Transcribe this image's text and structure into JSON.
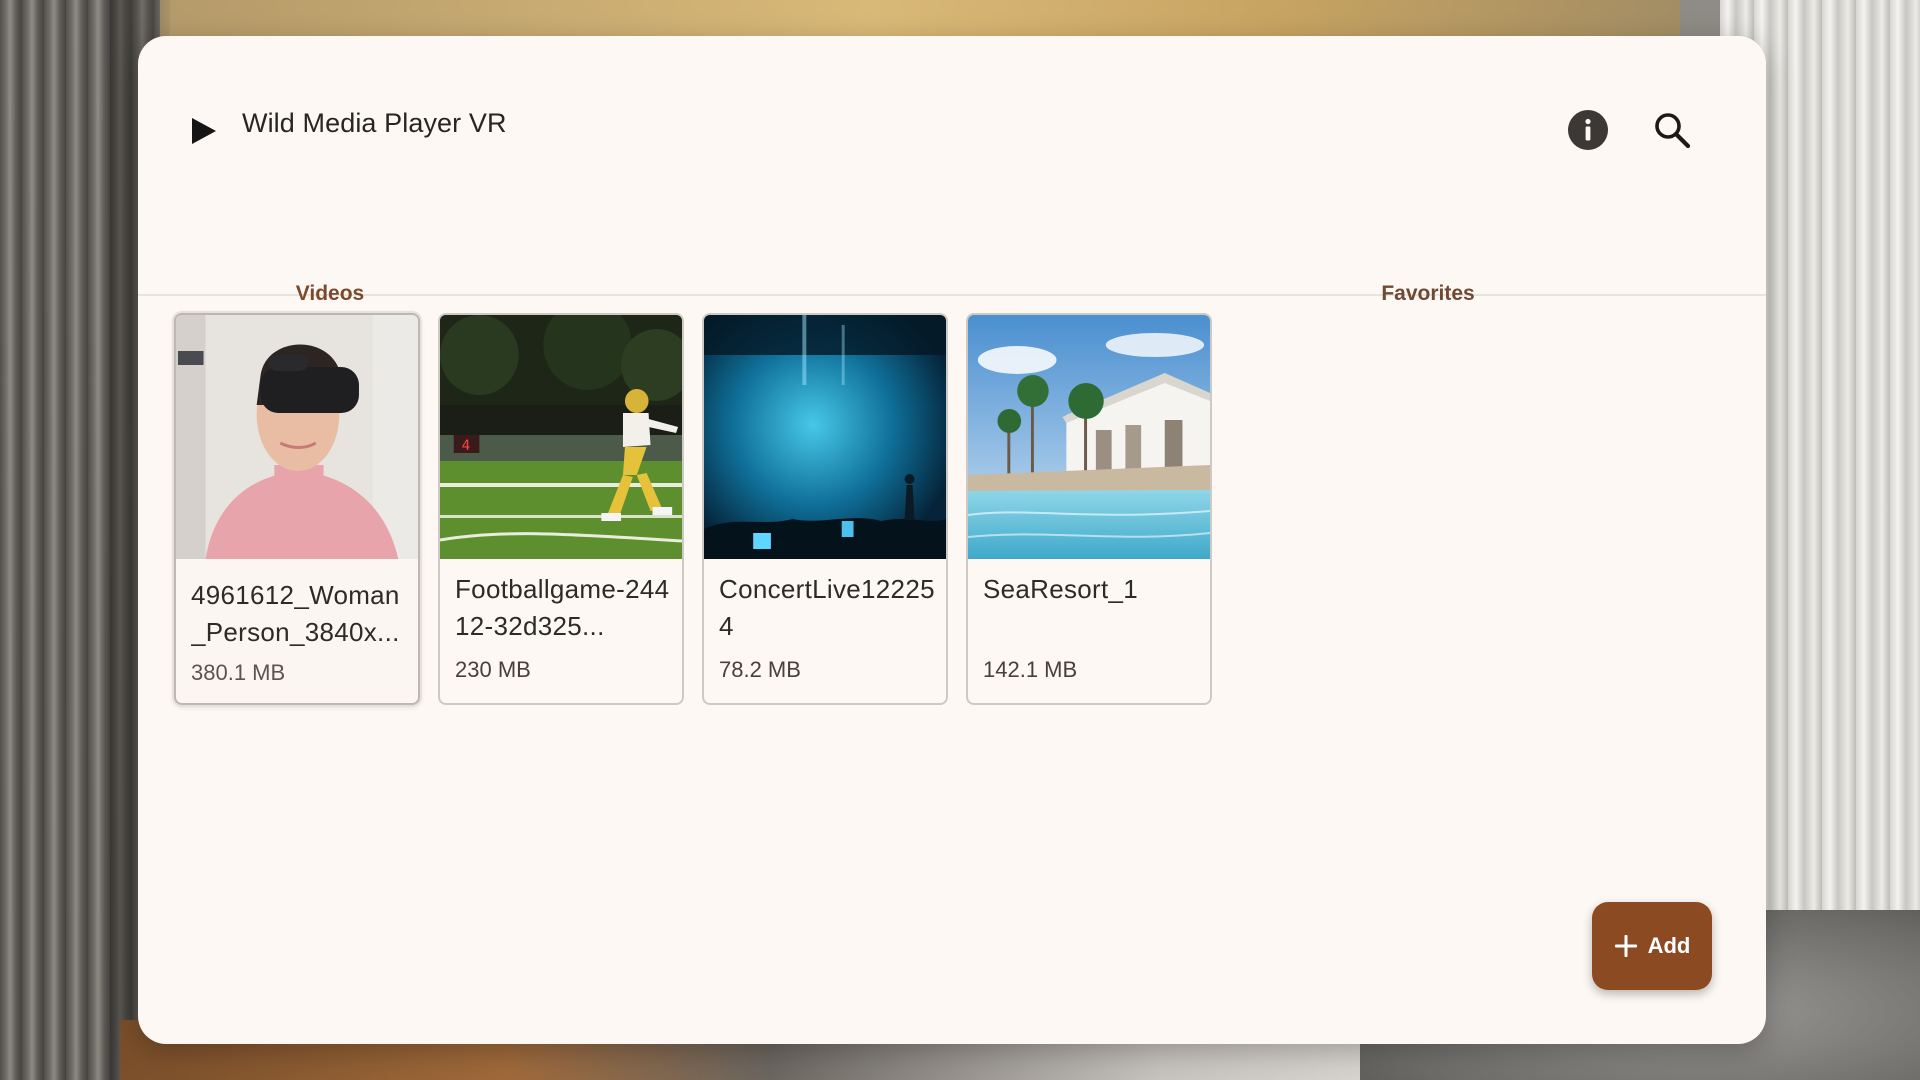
{
  "app": {
    "title": "Wild Media Player VR",
    "icons": {
      "play": "play-icon",
      "info": "info-icon",
      "search": "search-icon"
    }
  },
  "tabs": [
    {
      "label": "Videos",
      "active": true
    },
    {
      "label": "Favorites",
      "active": false
    }
  ],
  "videos": [
    {
      "title": "4961612_Woman_Person_3840x...",
      "size": "380.1 MB",
      "selected": true,
      "thumbnail": "woman-vr-headset"
    },
    {
      "title": "Footballgame-24412-32d325...",
      "size": "230 MB",
      "selected": false,
      "thumbnail": "football-player"
    },
    {
      "title": "ConcertLive122254",
      "size": "78.2 MB",
      "selected": false,
      "thumbnail": "concert-stage"
    },
    {
      "title": "SeaResort_1",
      "size": "142.1 MB",
      "selected": false,
      "thumbnail": "sea-resort-pool"
    }
  ],
  "fab": {
    "label": "Add",
    "icon": "plus-icon"
  },
  "colors": {
    "accent": "#8c4a23",
    "tab_text": "#7a4a2c",
    "panel_background": "#fdf8f4"
  }
}
